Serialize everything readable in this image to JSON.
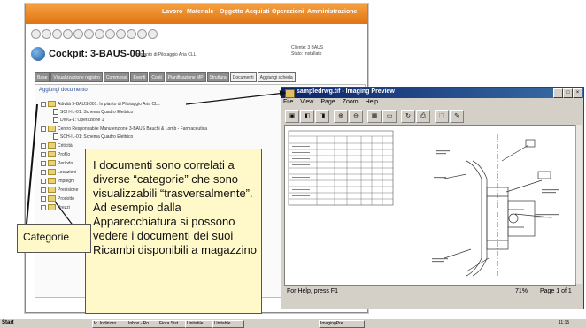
{
  "top_nav": [
    "Lavoro",
    "Materiale",
    "Oggetto",
    "Acquisti",
    "Operazioni",
    "Amministrazione"
  ],
  "cockpit": {
    "title": "Cockpit: 3-BAUS-001",
    "subtitle": "Impianto di Pilotaggio Aria CLL",
    "cliente": "Cliente: 3 BAUS",
    "stato": "Stato: Installato"
  },
  "tabs": [
    "Base",
    "Visualizzazione registro",
    "Commessi",
    "Eventi",
    "Costi",
    "Pianificazione MP",
    "Struttura",
    "Documenti",
    "Aggiungi scheda"
  ],
  "tree": {
    "aggiungi": "Aggiungi documento",
    "rows": [
      "Attività 3-BAUS-001: Impianto di Pilotaggio Aria CLL",
      "SCH-IL-01: Schema Quadro Elettrico",
      "DWG-1: Operazione 1",
      "Centro Responsabile Manutenzione 3-BAUS Bauchi & Lomb - Farmaceutica",
      "SCH-IL-01: Schema Quadro Elettrico",
      "Criticità",
      "Profilo",
      "Periodo",
      "Locazioni",
      "Impieghi",
      "Precisione",
      "Prodotto",
      "Prezzi"
    ]
  },
  "preview": {
    "title": "sampledrwg.tif - Imaging Preview",
    "menu": [
      "File",
      "View",
      "Page",
      "Zoom",
      "Help"
    ],
    "status_help": "For Help, press F1",
    "zoom": "71%",
    "page": "Page 1 of 1"
  },
  "callout": {
    "text": "I documenti sono correlati a diverse “categorie” che sono visualizzabili “trasversalmente”. Ad esempio dalla Apparecchiatura si possono vedere i documenti dei suoi Ricambi disponibili a magazzino",
    "categorie": "Categorie"
  },
  "taskbar": {
    "start": "Start",
    "tasks": [
      "Ic. Indirizzo...",
      "Inbox - Ro...",
      "Fiora Sist...",
      "Unitable...",
      "Unitable...",
      "ImagingPre..."
    ],
    "time": "11:15"
  },
  "colors": {
    "orange_bar": "#e07414",
    "callout_bg": "#fff8c8",
    "title_blue": "#0a246a"
  }
}
